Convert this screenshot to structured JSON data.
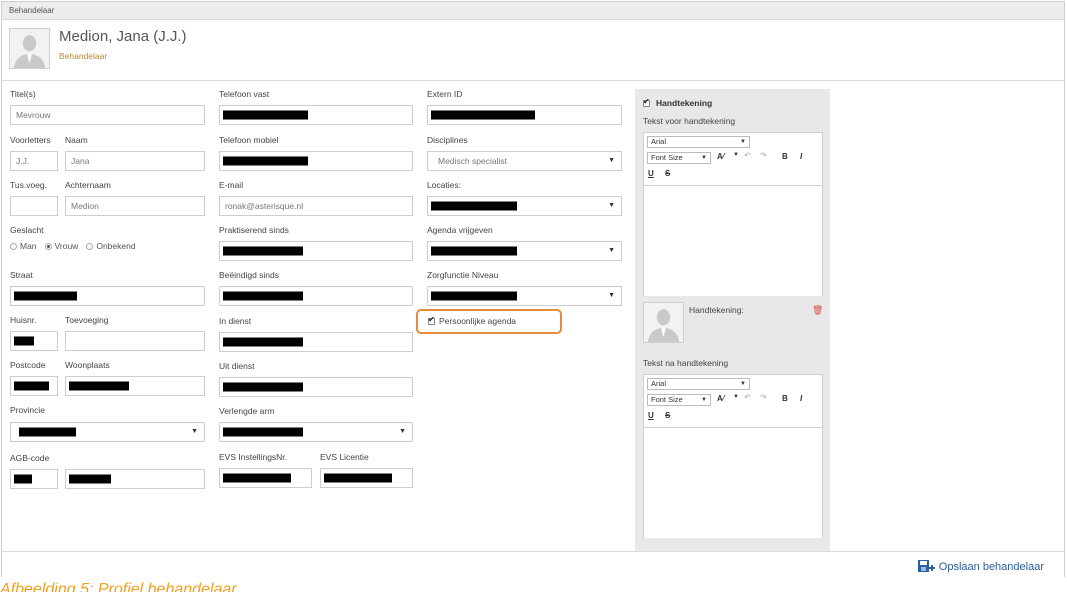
{
  "window": {
    "title": "Behandelaar"
  },
  "header": {
    "name": "Medion, Jana (J.J.)",
    "role": "Behandelaar"
  },
  "col1": {
    "titels_label": "Titel(s)",
    "titels_value": "Mevrouw",
    "voorletters_label": "Voorletters",
    "voorletters_value": "J.J.",
    "naam_label": "Naam",
    "naam_value": "Jana",
    "tusvoeg_label": "Tus.voeg.",
    "tusvoeg_value": "",
    "achternaam_label": "Achternaam",
    "achternaam_value": "Medion",
    "geslacht_label": "Geslacht",
    "geslacht_options": [
      "Man",
      "Vrouw",
      "Onbekend"
    ],
    "geslacht_selected": "Vrouw",
    "straat_label": "Straat",
    "huisnr_label": "Huisnr.",
    "toevoeging_label": "Toevoeging",
    "postcode_label": "Postcode",
    "woonplaats_label": "Woonplaats",
    "provincie_label": "Provincie",
    "agb_label": "AGB-code"
  },
  "col2": {
    "tel_vast_label": "Telefoon vast",
    "tel_mobiel_label": "Telefoon mobiel",
    "email_label": "E-mail",
    "email_value": "ronak@asterisque.nl",
    "prakt_label": "Praktiserend sinds",
    "beeindigd_label": "Beëindigd sinds",
    "in_dienst_label": "In dienst",
    "uit_dienst_label": "Uit dienst",
    "verlengde_arm_label": "Verlengde arm",
    "evs_inst_label": "EVS InstellingsNr.",
    "evs_lic_label": "EVS Licentie"
  },
  "col3": {
    "extern_id_label": "Extern ID",
    "disciplines_label": "Disciplines",
    "disciplines_value": "Medisch specialist",
    "locaties_label": "Locaties:",
    "agenda_label": "Agenda vrijgeven",
    "zorgfunctie_label": "Zorgfunctie Niveau",
    "persoonlijke_agenda_label": "Persoonlijke agenda"
  },
  "signature_panel": {
    "title": "Handtekening",
    "before_label": "Tekst voor handtekening",
    "font_value": "Arial",
    "size_value": "Font Size",
    "signature_label": "Handtekening:",
    "after_label": "Tekst na handtekening"
  },
  "footer": {
    "save_label": "Opslaan behandelaar"
  },
  "caption": "Afbeelding 5: Profiel behandelaar",
  "colors": {
    "accent": "#b8893f",
    "highlight": "#e88b3a",
    "link": "#2c5f9e",
    "caption": "#f0a020"
  }
}
